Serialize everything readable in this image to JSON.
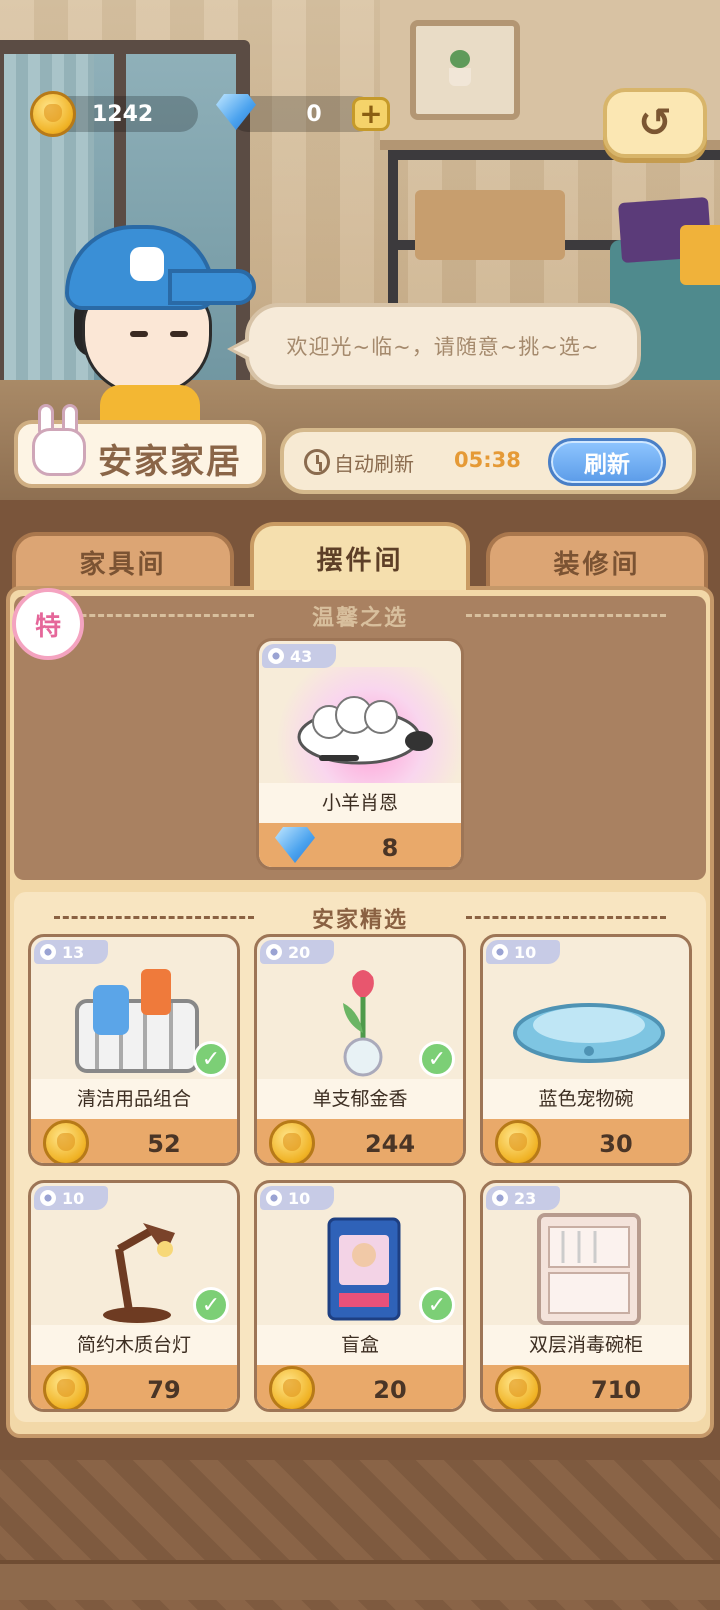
{
  "currency": {
    "coins": "1242",
    "gems": "0",
    "plus_label": "+"
  },
  "back_label": "↺",
  "speech": "欢迎光~临~，请随意~挑~选~",
  "shop_name": "安家家居",
  "refresh": {
    "auto_label": "自动刷新",
    "timer": "05:38",
    "button": "刷新"
  },
  "tabs": [
    {
      "label": "家具间",
      "active": false
    },
    {
      "label": "摆件间",
      "active": true
    },
    {
      "label": "装修间",
      "active": false
    }
  ],
  "special": {
    "badge": "特",
    "title": "温馨之选",
    "item": {
      "level": "43",
      "name": "小羊肖恩",
      "price": "8",
      "currency": "gem"
    }
  },
  "featured": {
    "title": "安家精选",
    "items": [
      {
        "level": "13",
        "name": "清洁用品组合",
        "price": "52",
        "owned": true,
        "icon": "cleaning-basket-icon"
      },
      {
        "level": "20",
        "name": "单支郁金香",
        "price": "244",
        "owned": true,
        "icon": "tulip-vase-icon"
      },
      {
        "level": "10",
        "name": "蓝色宠物碗",
        "price": "30",
        "owned": false,
        "icon": "pet-bowl-icon"
      },
      {
        "level": "10",
        "name": "简约木质台灯",
        "price": "79",
        "owned": true,
        "icon": "desk-lamp-icon"
      },
      {
        "level": "10",
        "name": "盲盒",
        "price": "20",
        "owned": true,
        "icon": "blind-box-icon"
      },
      {
        "level": "23",
        "name": "双层消毒碗柜",
        "price": "710",
        "owned": false,
        "icon": "dish-cabinet-icon"
      }
    ]
  }
}
